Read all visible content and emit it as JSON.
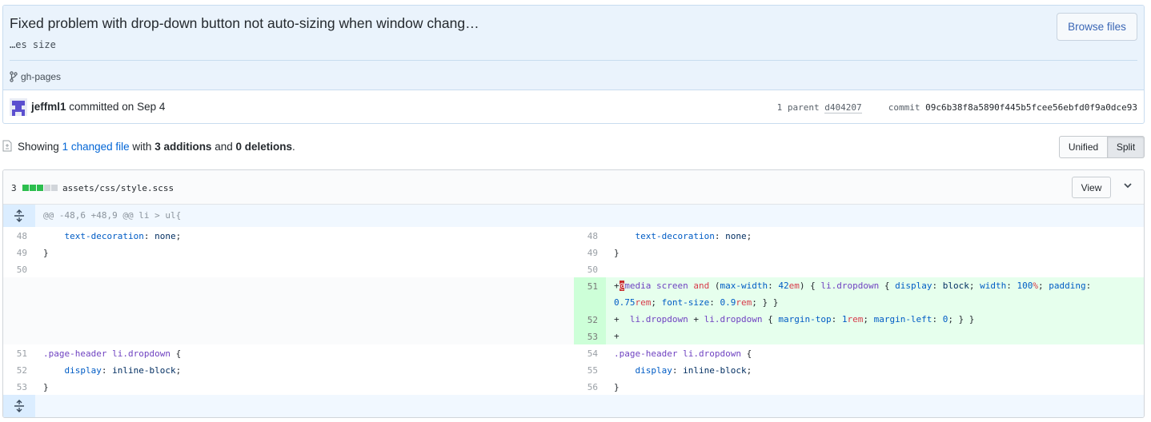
{
  "commit": {
    "title": "Fixed problem with drop-down button not auto-sizing when window chang…",
    "description": "…es size",
    "browse_button": "Browse files",
    "branch": "gh-pages",
    "author": "jeffml1",
    "committed_text": "committed on Sep 4",
    "parent_label": "1 parent",
    "parent_sha": "d404207",
    "commit_label": "commit",
    "commit_sha": "09c6b38f8a5890f445b5fcee56ebfd0f9a0dce93",
    "colors": {
      "header_bg": "#eaf3fc",
      "link": "#0366d6"
    }
  },
  "toc": {
    "showing": "Showing",
    "changed": "1 changed file",
    "with": "with",
    "additions": "3 additions",
    "and": "and",
    "deletions": "0 deletions",
    "period": ".",
    "unified_label": "Unified",
    "split_label": "Split",
    "selected_view": "Split"
  },
  "file": {
    "change_count": "3",
    "diffstat": [
      "added",
      "added",
      "added",
      "neutral",
      "neutral"
    ],
    "path": "assets/css/style.scss",
    "view_button": "View",
    "hunk_header": "@@ -48,6 +48,9 @@ li > ul{",
    "left_lines": [
      {
        "num": "48",
        "code": "    text-decoration: none;"
      },
      {
        "num": "49",
        "code": "}"
      },
      {
        "num": "50",
        "code": ""
      },
      {
        "num": "51",
        "code": ".page-header li.dropdown {"
      },
      {
        "num": "52",
        "code": "    display: inline-block;"
      },
      {
        "num": "53",
        "code": "}"
      }
    ],
    "right_lines": [
      {
        "num": "48",
        "code": "    text-decoration: none;"
      },
      {
        "num": "49",
        "code": "}"
      },
      {
        "num": "50",
        "code": ""
      },
      {
        "num": "51",
        "code": "+@media screen and (max-width: 42em) { li.dropdown { display: block; width: 100%; padding: 0.75rem; font-size: 0.9rem; } }",
        "added": true
      },
      {
        "num": "52",
        "code": "+  li.dropdown + li.dropdown { margin-top: 1rem; margin-left: 0; } }",
        "added": true
      },
      {
        "num": "53",
        "code": "+",
        "added": true
      },
      {
        "num": "54",
        "code": ".page-header li.dropdown {"
      },
      {
        "num": "55",
        "code": "    display: inline-block;"
      },
      {
        "num": "56",
        "code": "}"
      }
    ]
  }
}
